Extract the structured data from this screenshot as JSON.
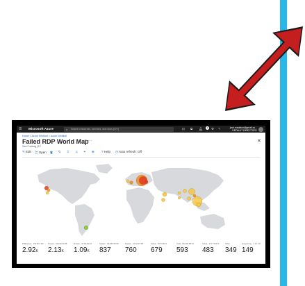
{
  "topbar": {
    "menu_icon": "hamburger-icon",
    "brand": "Microsoft Azure",
    "search_placeholder": "Search resources, services, and docs (G+/)",
    "icons": [
      "cloud-shell-icon",
      "directory-icon",
      "notifications-icon",
      "settings-icon",
      "help-icon",
      "feedback-icon"
    ],
    "notification_count": "1",
    "user_email": "josh.madakor@gmail.co...",
    "user_directory": "DEFAULT DIRECTORY"
  },
  "breadcrumb": {
    "home": "Home",
    "sep": ">",
    "item1": "Azure Sentinel",
    "item2": "Azure Sentinel"
  },
  "page": {
    "title": "Failed RDP World Map",
    "subtitle": "Saw Forebag (3/7"
  },
  "toolbar": {
    "edit": "Edit",
    "open": "Open",
    "help": "Help",
    "auto_refresh": "Auto refresh: Off"
  },
  "metrics": [
    {
      "label": "Philippines · PH 92.2 D3",
      "value": "2.92",
      "unit": "K"
    },
    {
      "label": "Russia · 94.232.44.08",
      "value": "2.13",
      "unit": "K"
    },
    {
      "label": "Russia · 47.94.04.04",
      "value": "1.09",
      "unit": "K"
    },
    {
      "label": "Taiwan · 60.253.55.58",
      "value": "837",
      "unit": ""
    },
    {
      "label": "Russia · 47.22.07.08",
      "value": "760",
      "unit": ""
    },
    {
      "label": "China · 56.73.53.2",
      "value": "679",
      "unit": ""
    },
    {
      "label": "India · 80.193.86.01",
      "value": "593",
      "unit": ""
    },
    {
      "label": "China · 177.72.95.2",
      "value": "483",
      "unit": ""
    },
    {
      "label": "Other",
      "value": "349",
      "unit": ""
    },
    {
      "label": "Hong Kong · 1.12.2.8",
      "value": "149",
      "unit": ""
    }
  ],
  "colors": {
    "accent_bar": "#29b6e8",
    "arrow": "#c41e1e",
    "bubble_red": "#e03a26",
    "bubble_orange": "#f08a2a",
    "bubble_yellow": "#f5c642",
    "bubble_green": "#8cc63f"
  }
}
